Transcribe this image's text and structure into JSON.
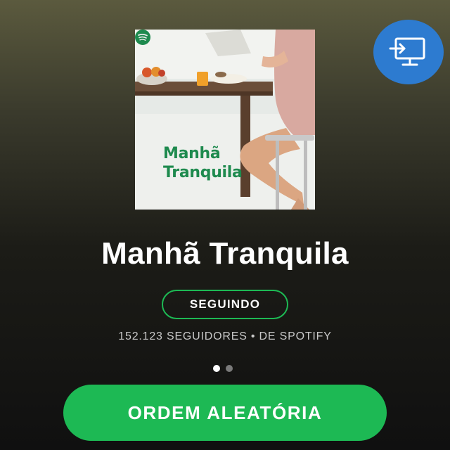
{
  "playlist": {
    "cover_title_line1": "Manhã",
    "cover_title_line2": "Tranquila",
    "cover_logo": "spotify-logo",
    "title": "Manhã Tranquila",
    "follow_label": "SEGUINDO",
    "meta": "152.123 SEGUIDORES • DE SPOTIFY"
  },
  "cast": {
    "icon": "cast-to-device-icon"
  },
  "pager": {
    "pages": 2,
    "active_index": 0
  },
  "actions": {
    "shuffle_label": "ORDEM ALEATÓRIA"
  },
  "colors": {
    "accent_green": "#1db954",
    "cast_blue": "#2d7bd0",
    "cover_text_green": "#1e8a4e"
  }
}
